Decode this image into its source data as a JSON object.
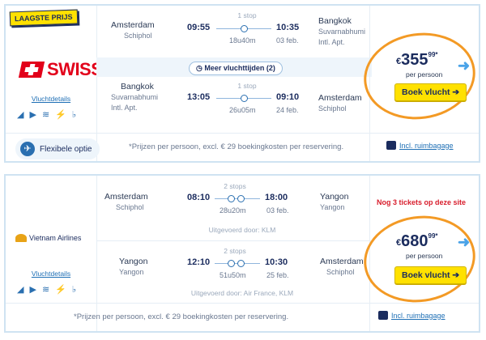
{
  "result1": {
    "badge": "LAAGSTE PRIJS",
    "airline": "SWISS",
    "details_link": "Vluchtdetails",
    "outbound": {
      "from_city": "Amsterdam",
      "from_airport": "Schiphol",
      "dep_time": "09:55",
      "stops": "1 stop",
      "duration": "18u40m",
      "arr_time": "10:35",
      "arr_date": "03 feb.",
      "to_city": "Bangkok",
      "to_airport": "Suvarnabhumi Intl. Apt."
    },
    "more_times": "Meer vluchttijden (2)",
    "inbound": {
      "from_city": "Bangkok",
      "from_airport": "Suvarnabhumi Intl. Apt.",
      "dep_time": "13:05",
      "stops": "1 stop",
      "duration": "26u05m",
      "arr_time": "09:10",
      "arr_date": "24 feb.",
      "to_city": "Amsterdam",
      "to_airport": "Schiphol"
    },
    "price_currency": "€",
    "price_amount": "355",
    "price_cents": "99*",
    "per_person": "per persoon",
    "book_label": "Boek vlucht ➔",
    "flex_option": "Flexibele optie",
    "footnote": "*Prijzen per persoon, excl. € 29 boekingkosten per reservering.",
    "baggage": "Incl. ruimbagage"
  },
  "result2": {
    "airline": "Vietnam Airlines",
    "details_link": "Vluchtdetails",
    "outbound": {
      "from_city": "Amsterdam",
      "from_airport": "Schiphol",
      "dep_time": "08:10",
      "stops": "2 stops",
      "duration": "28u20m",
      "arr_time": "18:00",
      "arr_date": "03 feb.",
      "to_city": "Yangon",
      "to_airport": "Yangon",
      "operated": "Uitgevoerd door: KLM"
    },
    "inbound": {
      "from_city": "Yangon",
      "from_airport": "Yangon",
      "dep_time": "12:10",
      "stops": "2 stops",
      "duration": "51u50m",
      "arr_time": "10:30",
      "arr_date": "25 feb.",
      "to_city": "Amsterdam",
      "to_airport": "Schiphol",
      "operated": "Uitgevoerd door: Air France, KLM"
    },
    "alert": "Nog 3 tickets op deze site",
    "price_currency": "€",
    "price_amount": "680",
    "price_cents": "99*",
    "per_person": "per persoon",
    "book_label": "Boek vlucht ➔",
    "footnote": "*Prijzen per persoon, excl. € 29 boekingkosten per reservering.",
    "baggage": "Incl. ruimbagage"
  },
  "colors": {
    "accent_yellow": "#ffe100",
    "highlight_orange": "#f39a25",
    "brand_navy": "#1b2c5e",
    "swiss_red": "#e2001a",
    "link_blue": "#1e6fb5"
  },
  "icons": [
    "seat-icon",
    "entertainment-icon",
    "wifi-icon",
    "power-icon",
    "meal-icon"
  ]
}
